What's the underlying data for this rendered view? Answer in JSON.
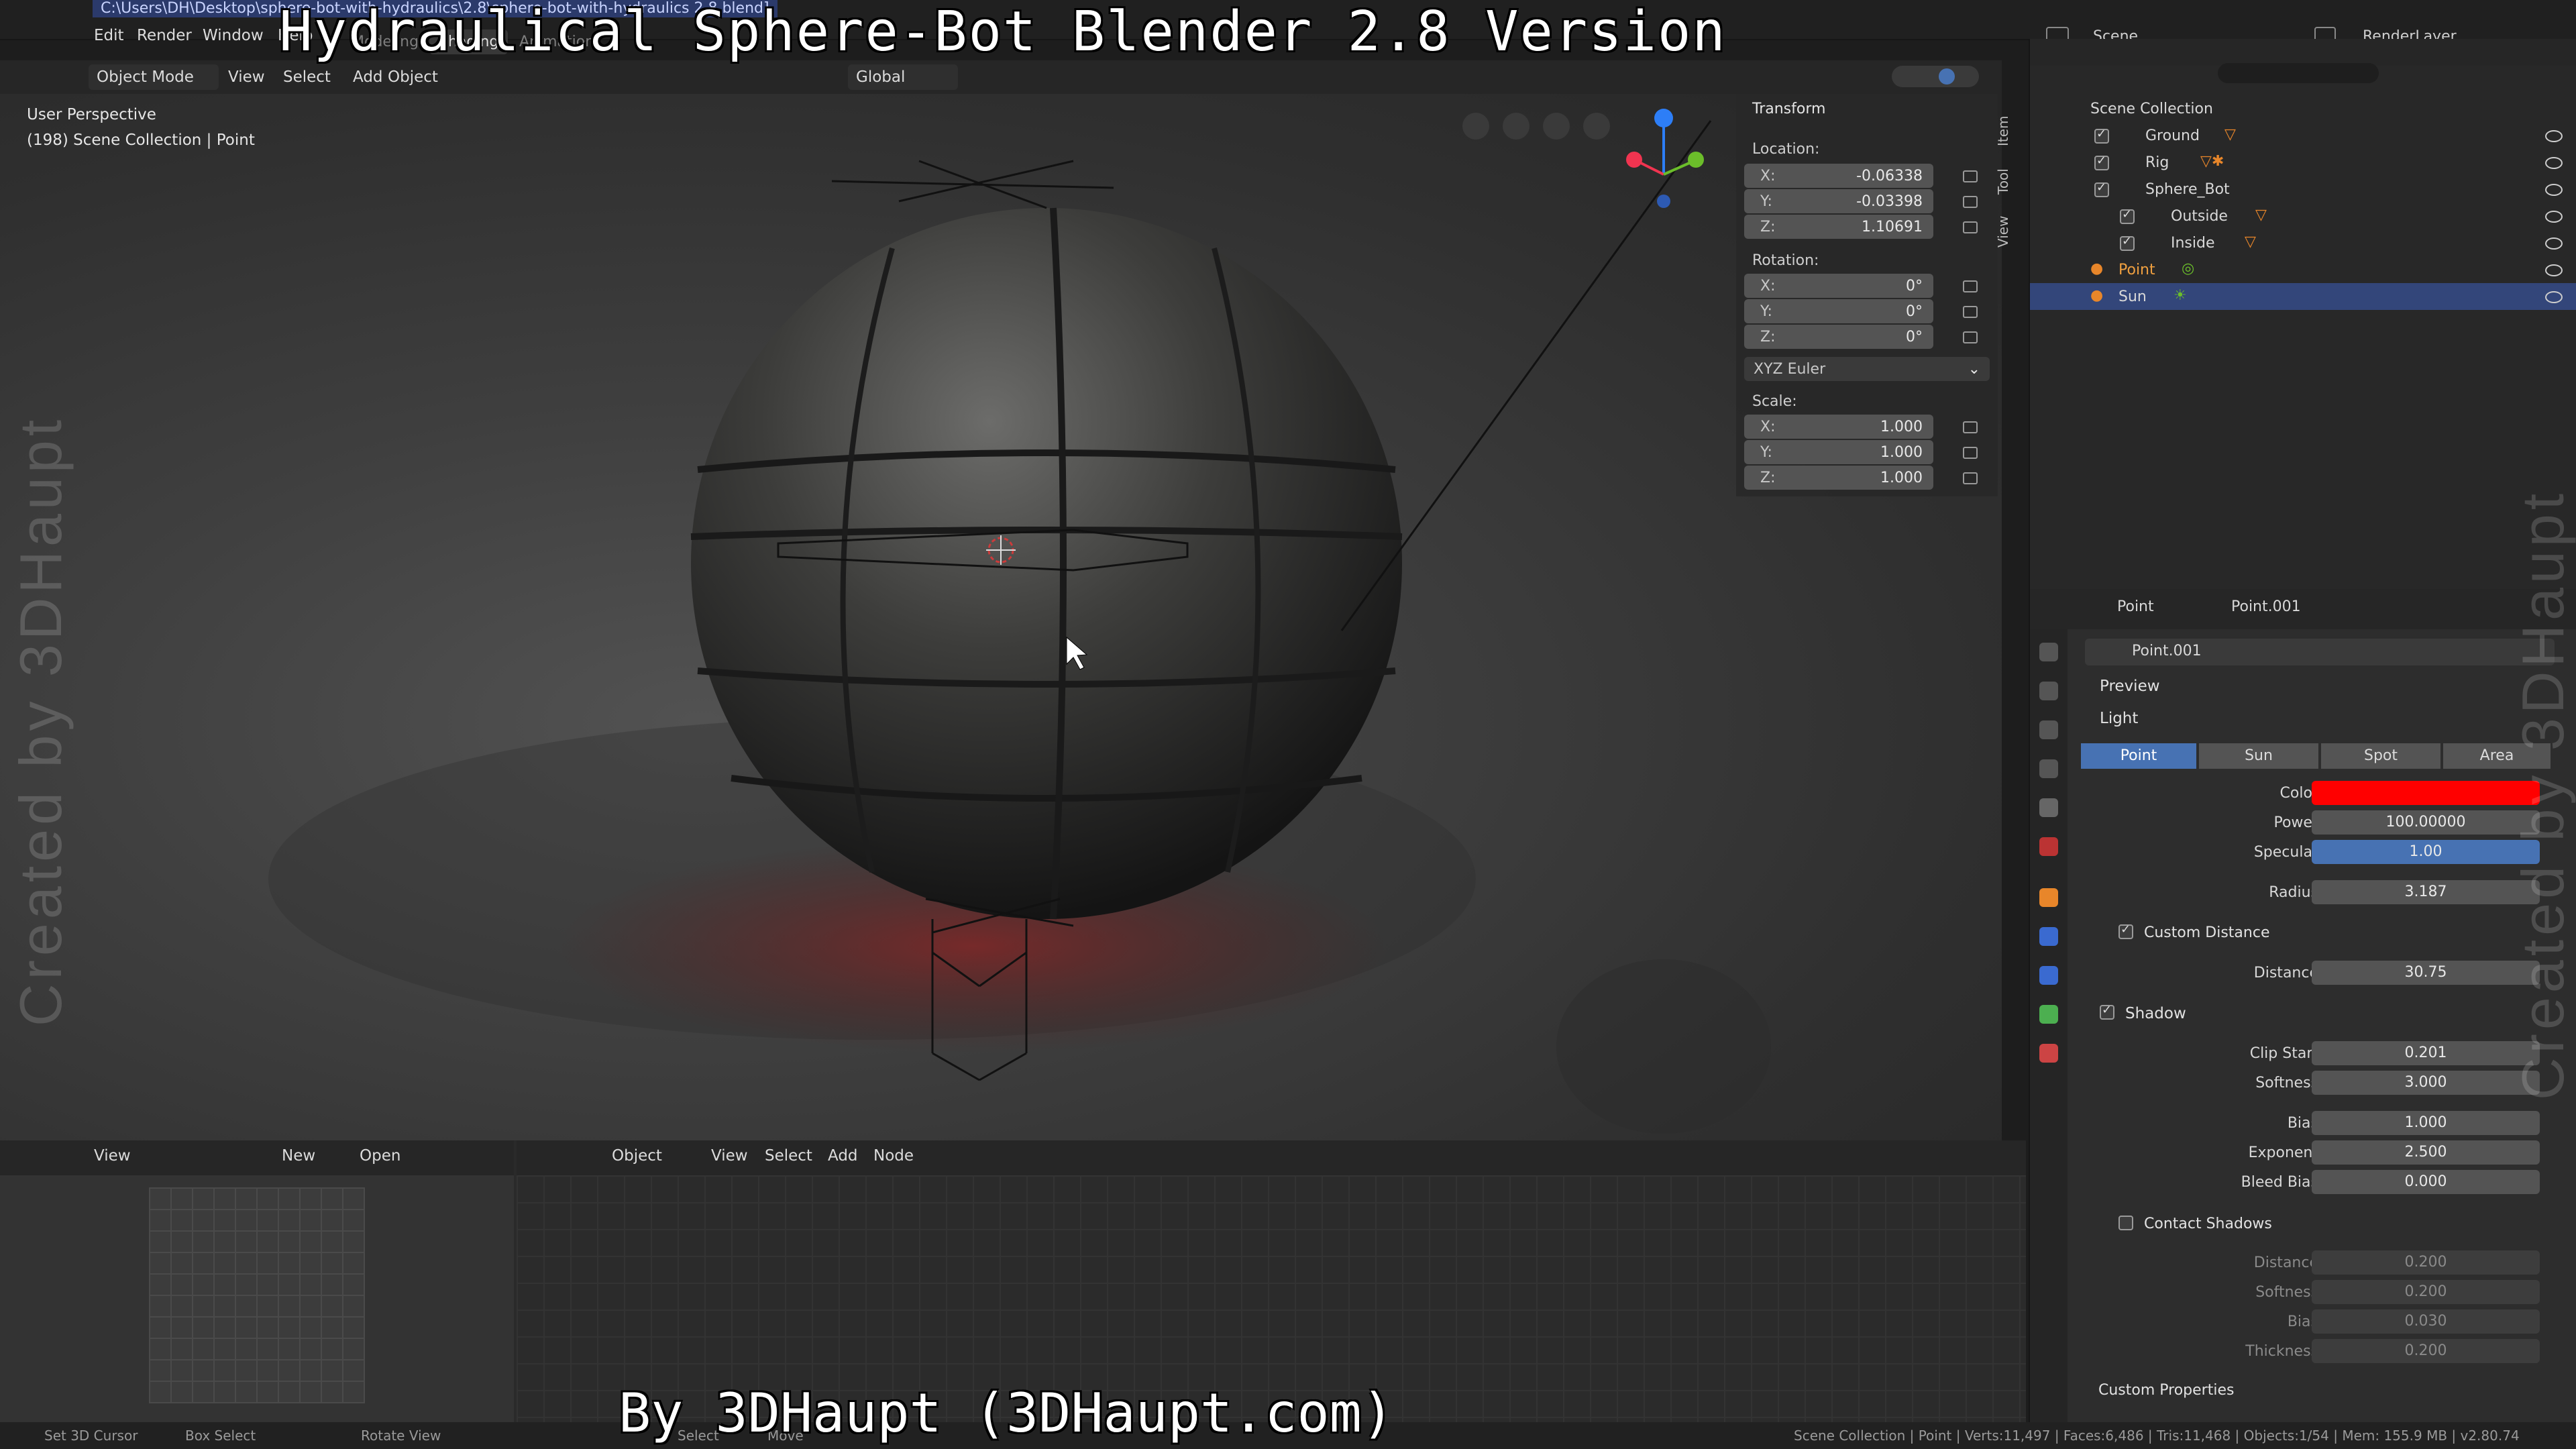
{
  "window": {
    "title_path": "C:\\Users\\DH\\Desktop\\sphere-bot-with-hydraulics\\2.8\\sphere-bot-with-hydraulics 2.8.blend]",
    "menus": [
      "Edit",
      "Render",
      "Window",
      "Help"
    ],
    "workspaces": [
      "Modeling",
      "Shading",
      "Animation"
    ],
    "active_workspace": "Shading",
    "scene_label": "Scene",
    "renderlayer_label": "RenderLayer"
  },
  "overlays": {
    "title": "Hydraulical Sphere-Bot Blender 2.8 Version",
    "credit": "By 3DHaupt (3DHaupt.com)",
    "watermark": "Created by 3DHaupt"
  },
  "viewport_toolbar": {
    "mode": "Object Mode",
    "menus": [
      "View",
      "Select",
      "Add",
      "Object"
    ],
    "transform_orientation": "Global"
  },
  "viewport": {
    "perspective": "User Perspective",
    "context": "(198) Scene Collection | Point",
    "side_tabs": [
      "Item",
      "Tool",
      "View"
    ]
  },
  "transform_panel": {
    "title": "Transform",
    "location_label": "Location:",
    "location": {
      "x": "-0.06338",
      "y": "-0.03398",
      "z": "1.10691"
    },
    "rotation_label": "Rotation:",
    "rotation": {
      "x": "0°",
      "y": "0°",
      "z": "0°"
    },
    "rotation_mode": "XYZ Euler",
    "scale_label": "Scale:",
    "scale": {
      "x": "1.000",
      "y": "1.000",
      "z": "1.000"
    },
    "axis_labels": {
      "x": "X:",
      "y": "Y:",
      "z": "Z:"
    }
  },
  "outliner": {
    "root": "Scene Collection",
    "items": [
      {
        "label": "Ground"
      },
      {
        "label": "Rig"
      },
      {
        "label": "Sphere_Bot"
      },
      {
        "label": "Outside"
      },
      {
        "label": "Inside"
      },
      {
        "label": "Point"
      },
      {
        "label": "Sun"
      }
    ]
  },
  "properties": {
    "object_name": "Point",
    "data_name": "Point.001",
    "datablock": "Point.001",
    "sections": {
      "preview": "Preview",
      "light": "Light",
      "custom_distance": "Custom Distance",
      "shadow": "Shadow",
      "contact_shadows": "Contact Shadows",
      "custom_properties": "Custom Properties"
    },
    "light_types": [
      "Point",
      "Sun",
      "Spot",
      "Area"
    ],
    "active_light_type": "Point",
    "fields": {
      "color_label": "Color",
      "color_value": "#ff0000",
      "power_label": "Power",
      "power": "100.00000",
      "specular_label": "Specular",
      "specular": "1.00",
      "radius_label": "Radius",
      "radius": "3.187",
      "distance_label": "Distance",
      "distance": "30.75",
      "clip_start_label": "Clip Start",
      "clip_start": "0.201",
      "softness_label": "Softness",
      "softness": "3.000",
      "bias_label": "Bias",
      "bias": "1.000",
      "exponent_label": "Exponent",
      "exponent": "2.500",
      "bleed_bias_label": "Bleed Bias",
      "bleed_bias": "0.000"
    },
    "contact": {
      "distance_label": "Distance",
      "distance": "0.200",
      "softness_label": "Softness",
      "softness": "0.200",
      "bias_label": "Bias",
      "bias": "0.030",
      "thickness_label": "Thickness",
      "thickness": "0.200"
    }
  },
  "image_editor": {
    "view": "View",
    "new": "New",
    "open": "Open"
  },
  "node_editor": {
    "type": "Object",
    "menus": [
      "View",
      "Select",
      "Add",
      "Node"
    ]
  },
  "statusbar": {
    "set_cursor": "Set 3D Cursor",
    "box_select": "Box Select",
    "rotate_view": "Rotate View",
    "select": "Select",
    "move": "Move",
    "stats": "Scene Collection | Point | Verts:11,497 | Faces:6,486 | Tris:11,468 | Objects:1/54 | Mem: 155.9 MB | v2.80.74"
  },
  "colors": {
    "accent": "#4772b3",
    "selection": "#33467a",
    "light_color": "#ff0000",
    "object_orange": "#e8862a"
  }
}
